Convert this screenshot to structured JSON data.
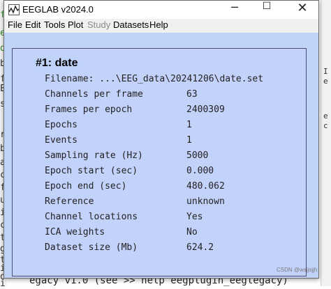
{
  "background": {
    "left_chars": [
      "f",
      "e",
      "d",
      "b",
      "f",
      "E",
      "s",
      "r",
      "b",
      "a",
      "c",
      "f",
      "u",
      "i",
      "c",
      "t",
      "g",
      "t",
      "i",
      "o",
      "i"
    ],
    "right_chars": [
      "I",
      "e",
      "e",
      "c"
    ],
    "bottom_line": "egacy  v1.0 (see >> help eegplugin_eeglegacy)"
  },
  "window": {
    "title": "EEGLAB v2024.0",
    "controls": {
      "minimize": "─",
      "maximize": "☐",
      "close": "✕"
    }
  },
  "menu": [
    {
      "label": "File",
      "enabled": true
    },
    {
      "label": "Edit",
      "enabled": true
    },
    {
      "label": "Tools",
      "enabled": true
    },
    {
      "label": "Plot",
      "enabled": true
    },
    {
      "label": "Study",
      "enabled": false
    },
    {
      "label": "Datasets",
      "enabled": true
    },
    {
      "label": "Help",
      "enabled": true
    }
  ],
  "dataset": {
    "title": "#1: date",
    "filename_line": "Filename: ...\\EEG_data\\20241206\\date.set",
    "rows": [
      {
        "label": "Channels per frame",
        "value": "63"
      },
      {
        "label": "Frames per epoch",
        "value": "2400309"
      },
      {
        "label": "Epochs",
        "value": "1"
      },
      {
        "label": "Events",
        "value": "1"
      },
      {
        "label": "Sampling rate (Hz)",
        "value": "5000"
      },
      {
        "label": "Epoch start (sec)",
        "value": " 0.000"
      },
      {
        "label": "Epoch end (sec)",
        "value": "480.062"
      },
      {
        "label": "Reference",
        "value": "unknown"
      },
      {
        "label": "Channel locations",
        "value": "Yes"
      },
      {
        "label": "ICA weights",
        "value": "No"
      },
      {
        "label": "Dataset size (Mb)",
        "value": "624.2"
      }
    ]
  },
  "watermark": "CSDN @wsjjsjjh",
  "colors": {
    "panel_background": "#c3d2fb",
    "panel_border": "#4b4b78",
    "disabled_menu": "#8a8a8a"
  }
}
